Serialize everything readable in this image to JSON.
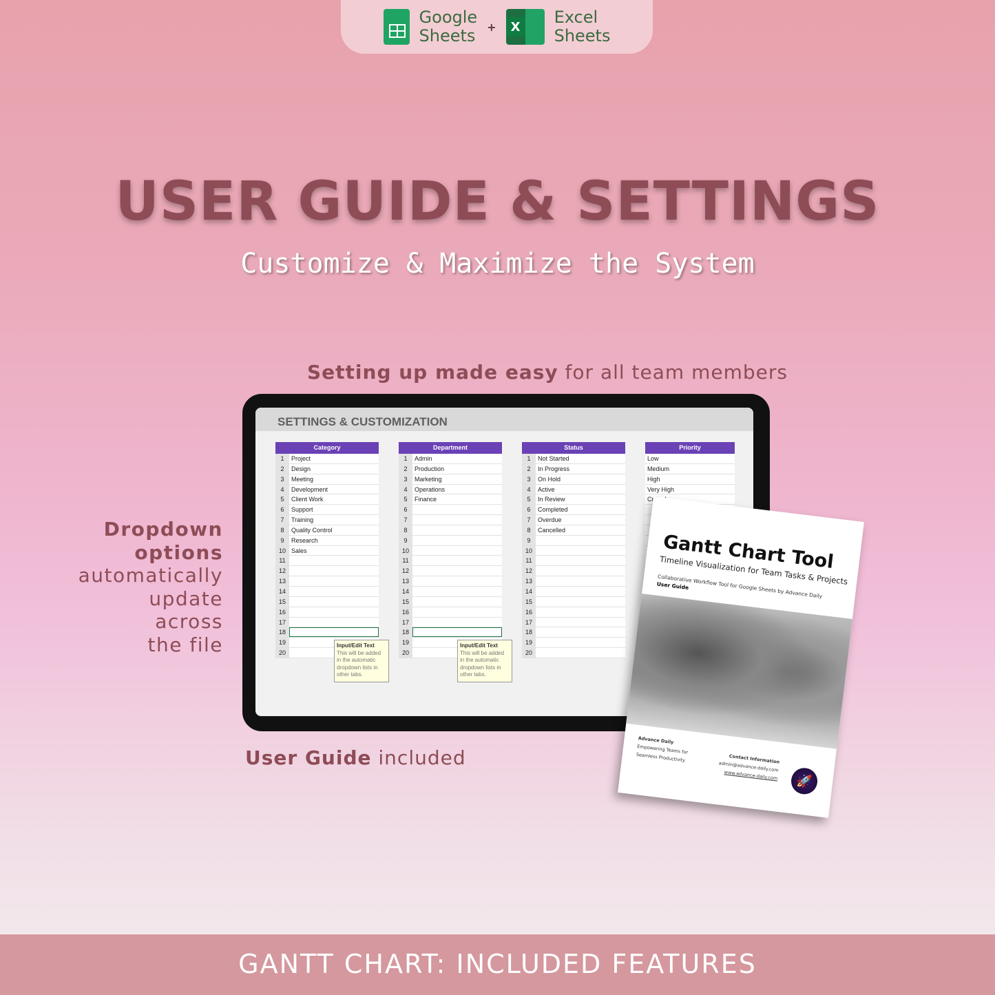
{
  "badge": {
    "google_line1": "Google",
    "google_line2": "Sheets",
    "plus": "+",
    "excel_line1": "Excel",
    "excel_line2": "Sheets",
    "excel_letter": "X"
  },
  "title": "USER GUIDE & SETTINGS",
  "subtitle": "Customize & Maximize the System",
  "caption_top": {
    "bold": "Setting up made easy",
    "rest": " for all team members"
  },
  "side_text": {
    "bold_lines": [
      "Dropdown",
      "options"
    ],
    "lines": [
      "automatically",
      "update",
      "across",
      "the file"
    ]
  },
  "caption_bottom": {
    "bold": "User Guide",
    "rest": " included"
  },
  "sheet": {
    "title": "SETTINGS & CUSTOMIZATION",
    "columns": [
      {
        "header": "Category",
        "numbered": true,
        "items": [
          "Project",
          "Design",
          "Meeting",
          "Development",
          "Client Work",
          "Support",
          "Training",
          "Quality Control",
          "Research",
          "Sales"
        ]
      },
      {
        "header": "Department",
        "numbered": true,
        "items": [
          "Admin",
          "Production",
          "Marketing",
          "Operations",
          "Finance"
        ]
      },
      {
        "header": "Status",
        "numbered": true,
        "items": [
          "Not Started",
          "In Progress",
          "On Hold",
          "Active",
          "In Review",
          "Completed",
          "Overdue",
          "Cancelled"
        ]
      },
      {
        "header": "Priority",
        "numbered": false,
        "items": [
          "Low",
          "Medium",
          "High",
          "Very High",
          "Critical"
        ]
      }
    ],
    "tooltip": {
      "title": "Input/Edit Text",
      "body": "This will be added in the automatic dropdown lists in other tabs."
    }
  },
  "booklet": {
    "title": "Gantt Chart Tool",
    "subtitle": "Timeline Visualization for Team Tasks & Projects",
    "tagline": "Collaborative Workflow Tool for Google Sheets by Advance Daily",
    "guide": "User Guide",
    "company": "Advance Daily",
    "slogan1": "Empowering Teams for",
    "slogan2": "Seamless Productivity",
    "contact_title": "Contact Information",
    "email": "admin@advance-daily.com",
    "website": "www.advance-daily.com"
  },
  "footer": "GANTT CHART: INCLUDED FEATURES",
  "colors": {
    "header_purple": "#6a42b5",
    "title_mauve": "#8e4c56",
    "footer_bar": "#d4989e"
  }
}
